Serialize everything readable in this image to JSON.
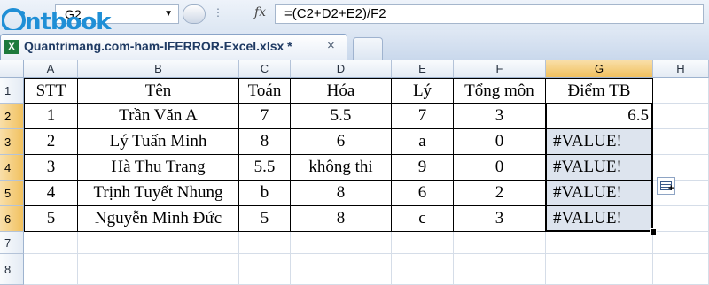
{
  "logo_text": "ntbook",
  "formula_bar": {
    "name_box": "G2",
    "fx_label": "fx",
    "formula": "=(C2+D2+E2)/F2"
  },
  "tabs": {
    "document_title": "Quantrimang.com-ham-IFERROR-Excel.xlsx *",
    "close_glyph": "×"
  },
  "columns": [
    "A",
    "B",
    "C",
    "D",
    "E",
    "F",
    "G",
    "H"
  ],
  "rows": [
    "1",
    "2",
    "3",
    "4",
    "5",
    "6",
    "7",
    "8"
  ],
  "table": {
    "headers": [
      "STT",
      "Tên",
      "Toán",
      "Hóa",
      "Lý",
      "Tổng môn",
      "Điểm TB"
    ],
    "data": [
      [
        "1",
        "Trần Văn A",
        "7",
        "5.5",
        "7",
        "3",
        "6.5"
      ],
      [
        "2",
        "Lý Tuấn Minh",
        "8",
        "6",
        "a",
        "0",
        "#VALUE!"
      ],
      [
        "3",
        "Hà Thu Trang",
        "5.5",
        "không thi",
        "9",
        "0",
        "#VALUE!"
      ],
      [
        "4",
        "Trịnh Tuyết Nhung",
        "b",
        "8",
        "6",
        "2",
        "#VALUE!"
      ],
      [
        "5",
        "Nguyễn Minh Đức",
        "5",
        "8",
        "c",
        "3",
        "#VALUE!"
      ]
    ]
  },
  "selection": {
    "active_cell": "G2",
    "range": "G2:G6"
  },
  "colors": {
    "selection_header": "#f1c15f",
    "error_indicator": "#1e8c3a",
    "logo": "#1f8fd6"
  }
}
